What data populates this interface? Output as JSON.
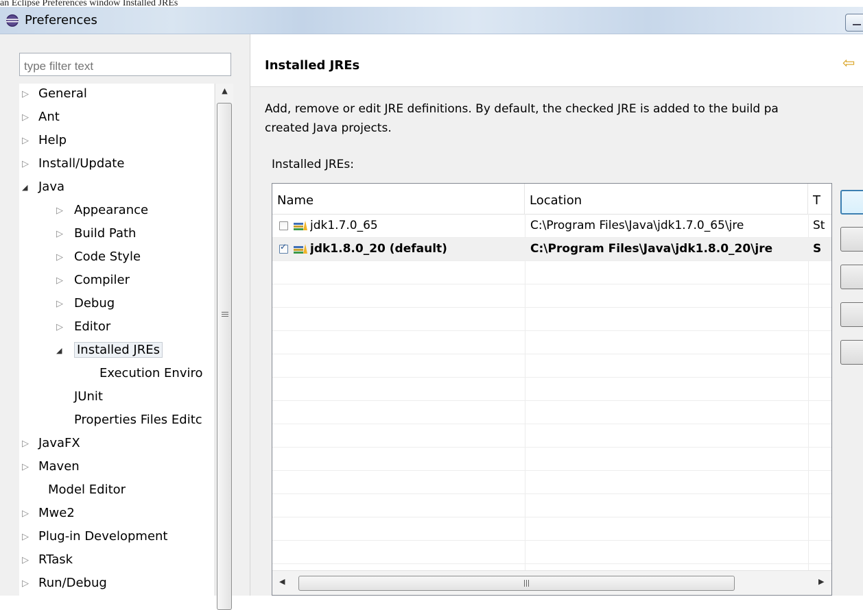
{
  "caption": "an Eclipse Preferences window Installed JREs",
  "window": {
    "title": "Preferences"
  },
  "filter": {
    "placeholder": "type filter text"
  },
  "tree": {
    "items": [
      {
        "label": "General",
        "expander": "▷"
      },
      {
        "label": "Ant",
        "expander": "▷"
      },
      {
        "label": "Help",
        "expander": "▷"
      },
      {
        "label": "Install/Update",
        "expander": "▷"
      },
      {
        "label": "Java",
        "expander": "◢"
      },
      {
        "label": "Appearance",
        "expander": "▷"
      },
      {
        "label": "Build Path",
        "expander": "▷"
      },
      {
        "label": "Code Style",
        "expander": "▷"
      },
      {
        "label": "Compiler",
        "expander": "▷"
      },
      {
        "label": "Debug",
        "expander": "▷"
      },
      {
        "label": "Editor",
        "expander": "▷"
      },
      {
        "label": "Installed JREs",
        "expander": "◢"
      },
      {
        "label": "Execution Enviro",
        "expander": ""
      },
      {
        "label": "JUnit",
        "expander": ""
      },
      {
        "label": "Properties Files Editc",
        "expander": ""
      },
      {
        "label": "JavaFX",
        "expander": "▷"
      },
      {
        "label": "Maven",
        "expander": "▷"
      },
      {
        "label": "Model Editor",
        "expander": ""
      },
      {
        "label": "Mwe2",
        "expander": "▷"
      },
      {
        "label": "Plug-in Development",
        "expander": "▷"
      },
      {
        "label": "RTask",
        "expander": "▷"
      },
      {
        "label": "Run/Debug",
        "expander": "▷"
      }
    ]
  },
  "page": {
    "title": "Installed JREs",
    "description_line1": "Add, remove or edit JRE definitions. By default, the checked JRE is added to the build pa",
    "description_line2": "created Java projects.",
    "list_label": "Installed JREs:"
  },
  "table": {
    "columns": [
      "Name",
      "Location",
      "T"
    ],
    "rows": [
      {
        "name": "jdk1.7.0_65",
        "location": "C:\\Program Files\\Java\\jdk1.7.0_65\\jre",
        "type": "St",
        "checked": false
      },
      {
        "name": "jdk1.8.0_20 (default)",
        "location": "C:\\Program Files\\Java\\jdk1.8.0_20\\jre",
        "type": "S",
        "checked": true
      }
    ]
  },
  "scroll": {
    "left_arrow": "◀",
    "right_arrow": "▶",
    "up_arrow": "▲"
  },
  "colors": {
    "accent_border": "#3c7fb1",
    "back_arrow": "#d8a21f",
    "selection": "#f0f0f0"
  },
  "icons": {
    "window": "eclipse-icon",
    "back": "back-arrow-icon",
    "jre": "jre-library-icon"
  }
}
